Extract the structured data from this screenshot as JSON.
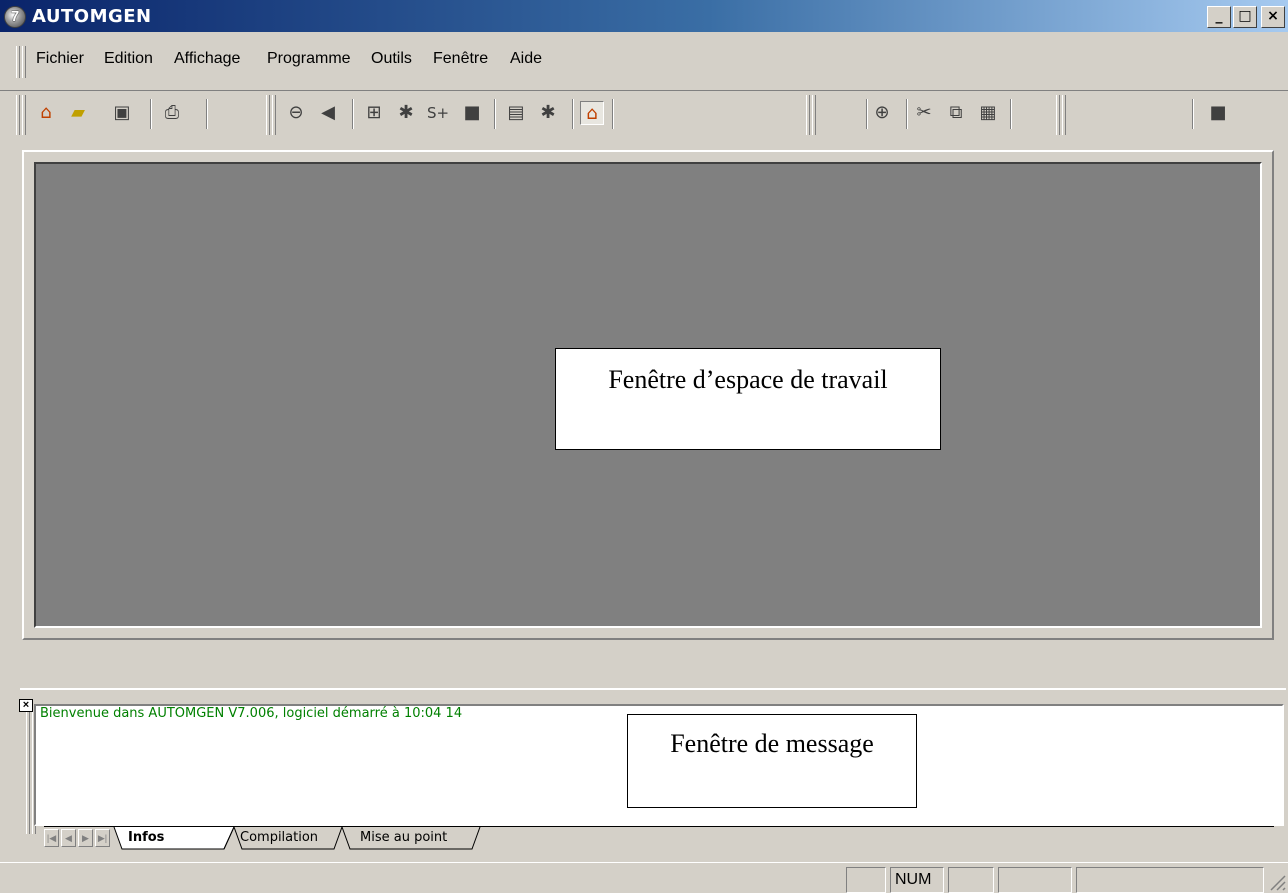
{
  "window": {
    "title": "AUTOMGEN",
    "icon_glyph": "7",
    "minimize": "_",
    "maximize": "□",
    "close": "×"
  },
  "menu": {
    "items": [
      "Fichier",
      "Edition",
      "Affichage",
      "Programme",
      "Outils",
      "Fenêtre",
      "Aide"
    ]
  },
  "toolbar": {
    "icons": [
      "new-project-icon",
      "open-folder-icon",
      "save-icon",
      "print-icon",
      "zoom-out-icon",
      "arrow-icon",
      "expand-icon",
      "compile-icon",
      "step-icon",
      "stop-icon",
      "new-document-icon",
      "go-icon",
      "project-active-icon",
      "zoom-in-icon",
      "cut-icon",
      "copy-icon",
      "paste-icon",
      "color-box-icon"
    ]
  },
  "workspace": {
    "callout": "Fenêtre d’espace de travail"
  },
  "messages": {
    "close_glyph": "×",
    "line": "Bienvenue dans AUTOMGEN V7.006, logiciel démarré à 10:04 14",
    "callout": "Fenêtre de message",
    "tabs": [
      "Infos",
      "Compilation",
      "Mise au point"
    ],
    "text_color": "#008000"
  },
  "statusbar": {
    "num": "NUM"
  }
}
